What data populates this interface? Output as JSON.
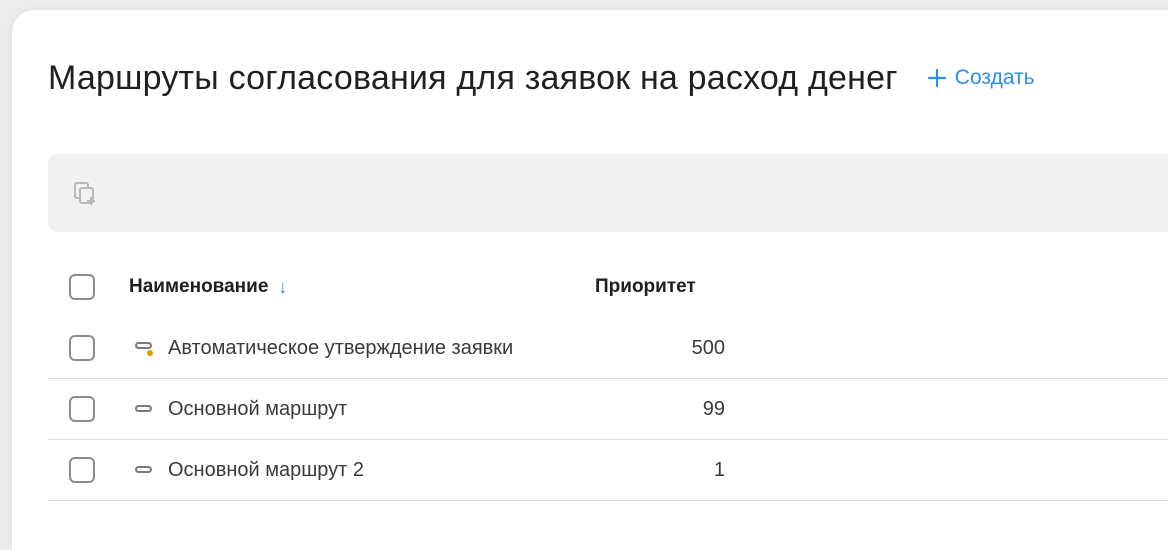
{
  "header": {
    "title": "Маршруты согласования для заявок на расход денег",
    "create_label": "Создать",
    "accent_color": "#2b8ef0"
  },
  "toolbar": {
    "copy_icon": "copy-add-icon"
  },
  "table": {
    "columns": {
      "name": "Наименование",
      "priority": "Приоритет",
      "sort_indicator": "↓"
    },
    "rows": [
      {
        "name": "Автоматическое утверждение заявки",
        "priority": "500",
        "icon": "route-icon",
        "status_dot_color": "#d4a500"
      },
      {
        "name": "Основной маршрут",
        "priority": "99",
        "icon": "route-icon"
      },
      {
        "name": "Основной маршрут 2",
        "priority": "1",
        "icon": "route-icon"
      }
    ]
  }
}
